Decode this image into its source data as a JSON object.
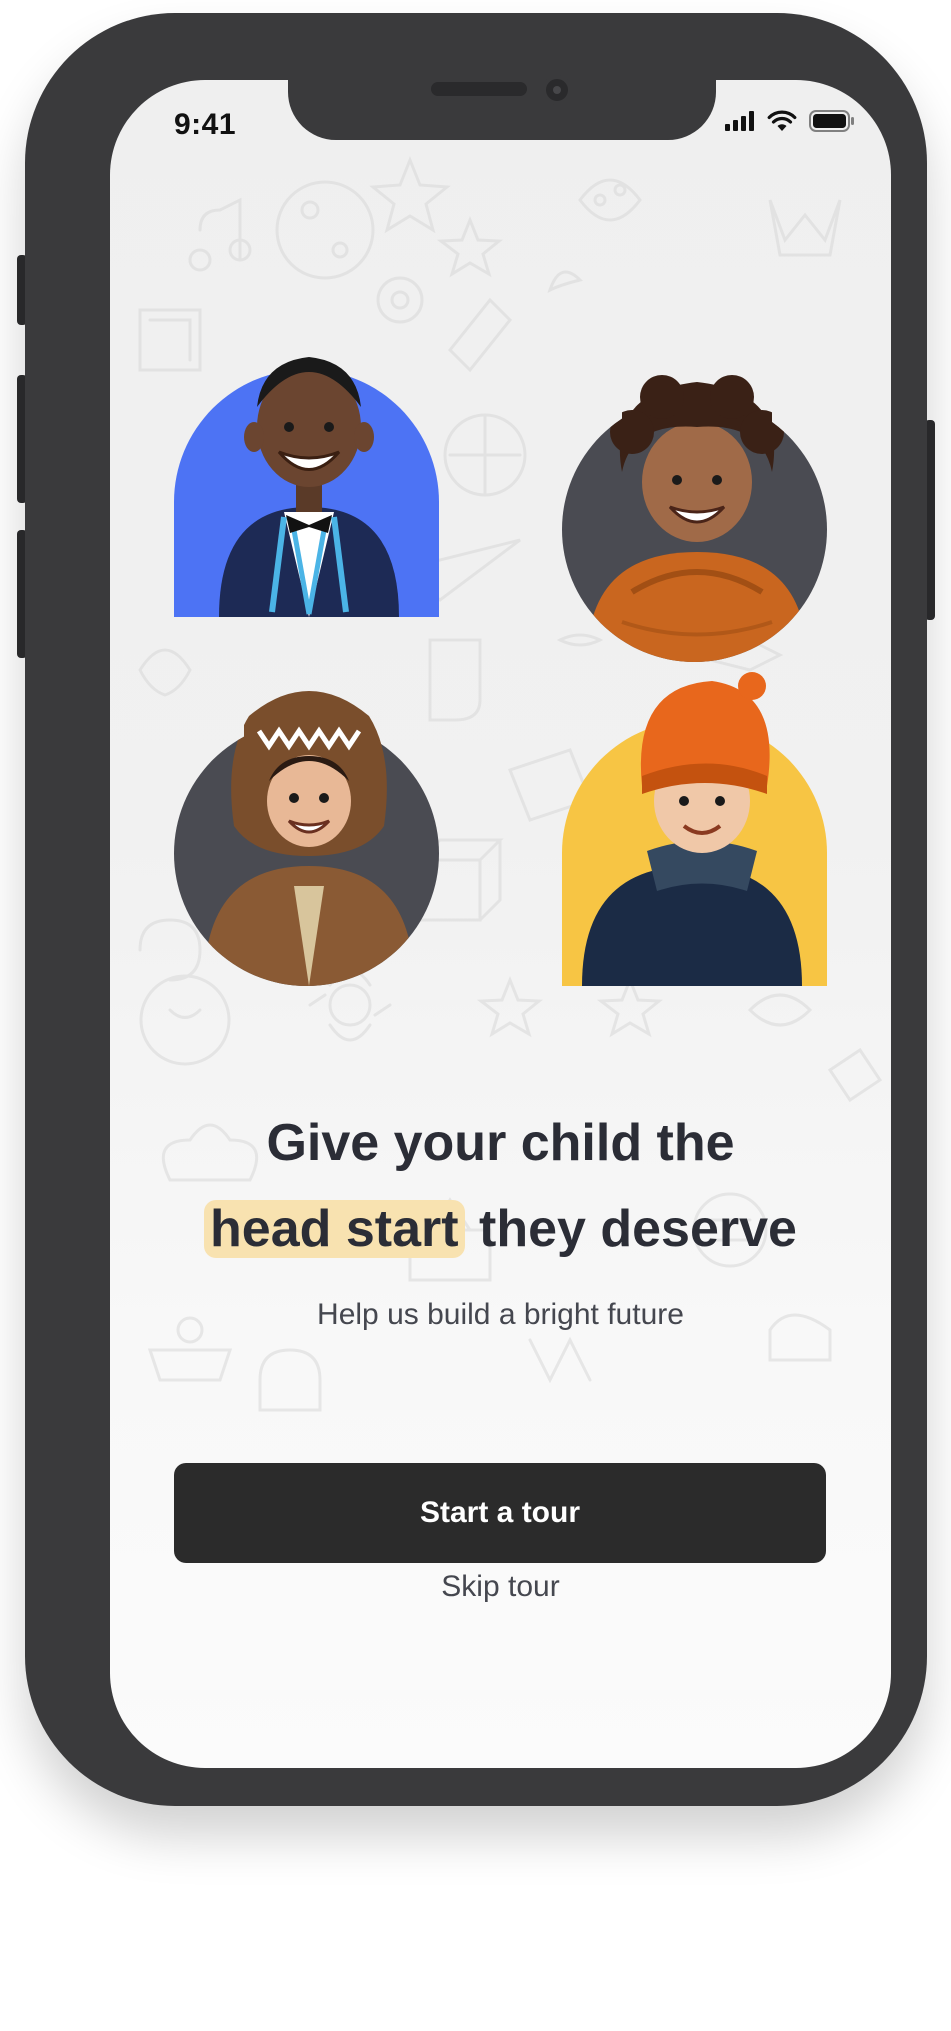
{
  "status_bar": {
    "time": "9:41"
  },
  "onboarding": {
    "title_line1": "Give your child the",
    "title_highlight": "head start",
    "title_rest": "they deserve",
    "subtitle": "Help us build a bright future",
    "primary_button": "Start a tour",
    "secondary_link": "Skip tour"
  },
  "avatars": [
    {
      "name": "child-in-cardigan",
      "background": "#4d73f4",
      "shape": "arch-left"
    },
    {
      "name": "child-in-orange-hoodie",
      "background": "#4a4b52",
      "shape": "circle"
    },
    {
      "name": "child-in-dino-costume",
      "background": "#4a4b52",
      "shape": "circle"
    },
    {
      "name": "child-in-orange-beanie",
      "background": "#f7c544",
      "shape": "arch-right"
    }
  ],
  "colors": {
    "frame": "#3a3a3c",
    "primary_button_bg": "#2b2b2b",
    "title_text": "#2b2d36",
    "highlight": "#f8e2b0"
  },
  "icons": [
    "cellular-signal-icon",
    "wifi-icon",
    "battery-icon"
  ]
}
